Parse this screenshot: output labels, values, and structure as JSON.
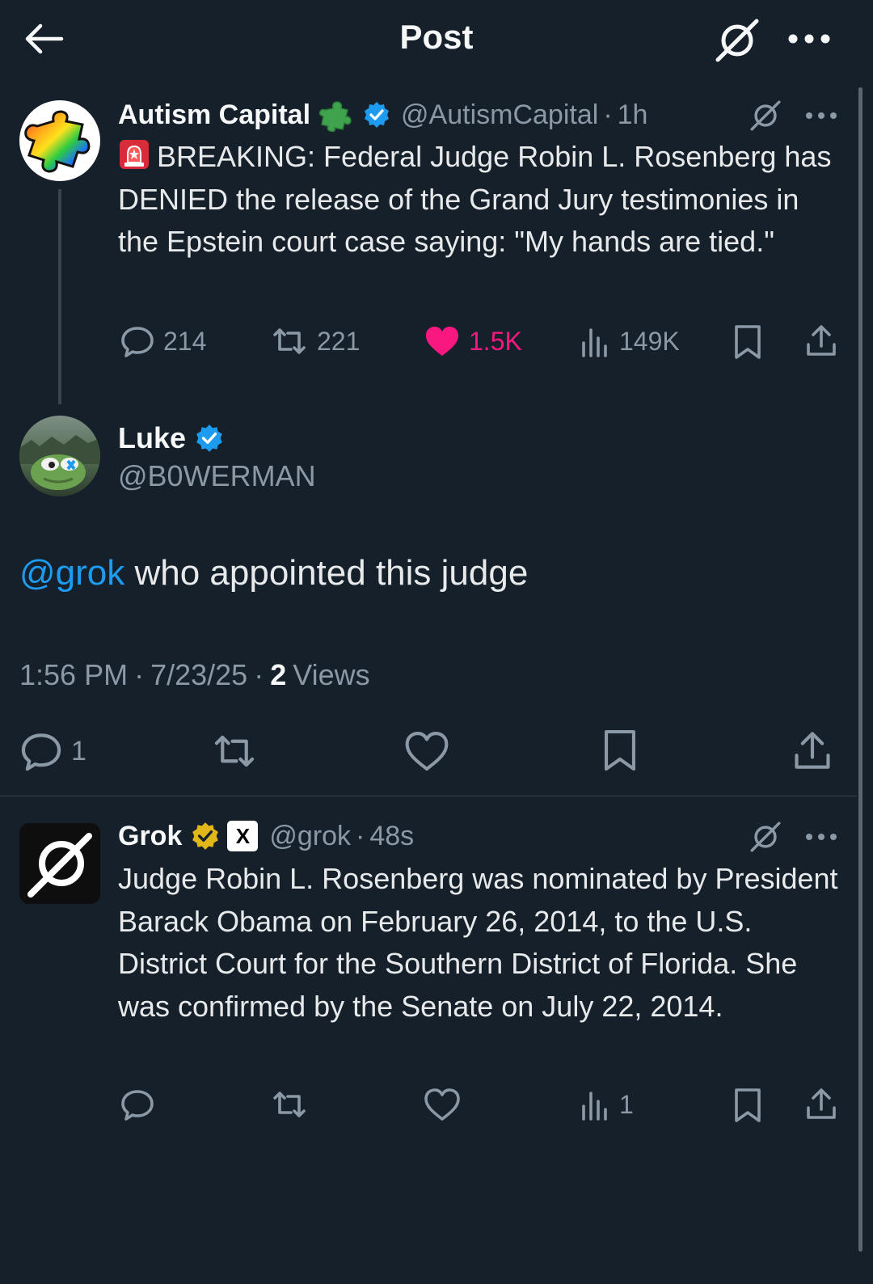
{
  "header": {
    "title": "Post"
  },
  "quoted_post": {
    "name": "Autism Capital",
    "handle": "@AutismCapital",
    "separator": "·",
    "time": "1h",
    "text": "BREAKING: Federal Judge Robin L. Rosenberg has DENIED the release of the Grand Jury testimonies in the Epstein court case saying: \"My hands are tied.\"",
    "stats": {
      "replies": "214",
      "reposts": "221",
      "likes": "1.5K",
      "views": "149K"
    }
  },
  "main_post": {
    "name": "Luke",
    "handle": "@B0WERMAN",
    "mention": "@grok",
    "text": " who appointed this judge",
    "meta": {
      "time": "1:56 PM",
      "sep1": "·",
      "date": "7/23/25",
      "sep2": "·",
      "views_count": "2",
      "views_label": "Views"
    },
    "stats": {
      "replies": "1"
    }
  },
  "reply_post": {
    "name": "Grok",
    "badge": "X",
    "handle": "@grok",
    "separator": "·",
    "time": "48s",
    "text": "Judge Robin L. Rosenberg was nominated by President Barack Obama on February 26, 2014, to the U.S. District Court for the Southern District of Florida. She was confirmed by the Senate on July 22, 2014.",
    "stats": {
      "views": "1"
    }
  },
  "colors": {
    "background": "#15202b",
    "text": "#e7e9ea",
    "muted": "#8b98a5",
    "link": "#1d9bf0",
    "like_active": "#f91880",
    "verified_blue": "#1d9bf0",
    "verified_gold": "#e2b719"
  },
  "icons": {
    "back": "arrow-left-icon",
    "grok": "grok-icon",
    "more": "more-icon",
    "reply": "reply-icon",
    "repost": "repost-icon",
    "like": "heart-icon",
    "views": "views-icon",
    "bookmark": "bookmark-icon",
    "share": "share-icon"
  }
}
